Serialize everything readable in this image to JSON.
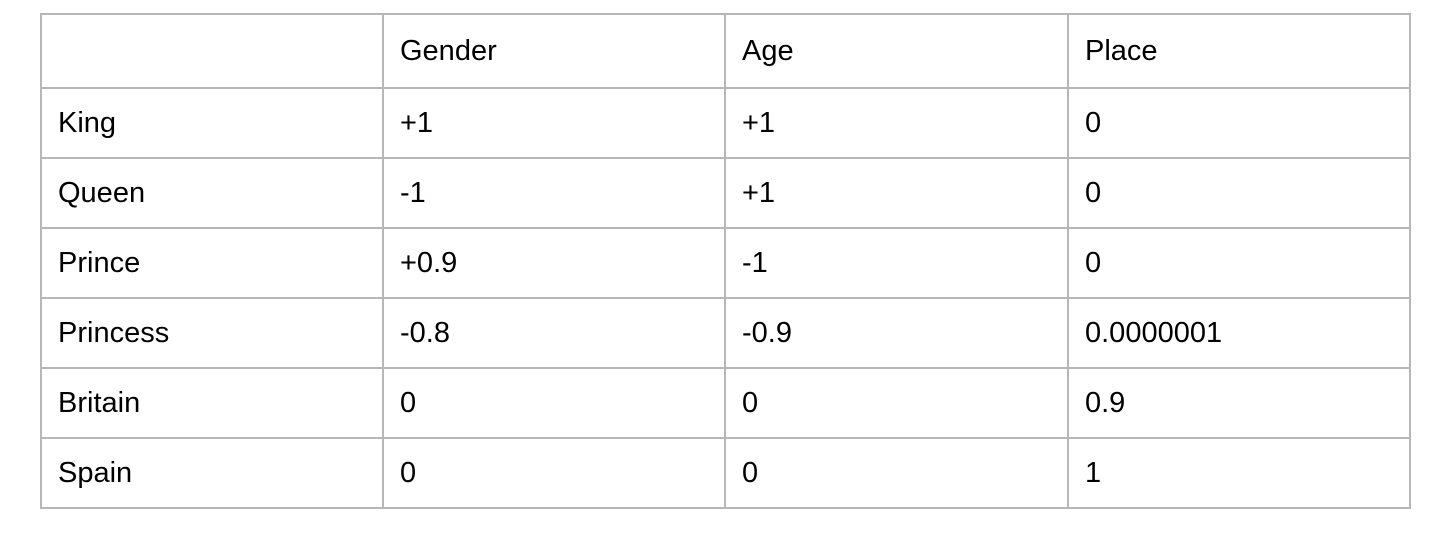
{
  "table": {
    "headers": [
      "",
      "Gender",
      "Age",
      "Place"
    ],
    "rows": [
      [
        "King",
        "+1",
        "+1",
        "0"
      ],
      [
        "Queen",
        "-1",
        "+1",
        "0"
      ],
      [
        "Prince",
        "+0.9",
        "-1",
        "0"
      ],
      [
        "Princess",
        "-0.8",
        "-0.9",
        "0.0000001"
      ],
      [
        "Britain",
        "0",
        "0",
        "0.9"
      ],
      [
        "Spain",
        "0",
        "0",
        "1"
      ]
    ]
  },
  "colors": {
    "border": "#b7b7b7",
    "text": "#000000",
    "background": "#ffffff"
  }
}
